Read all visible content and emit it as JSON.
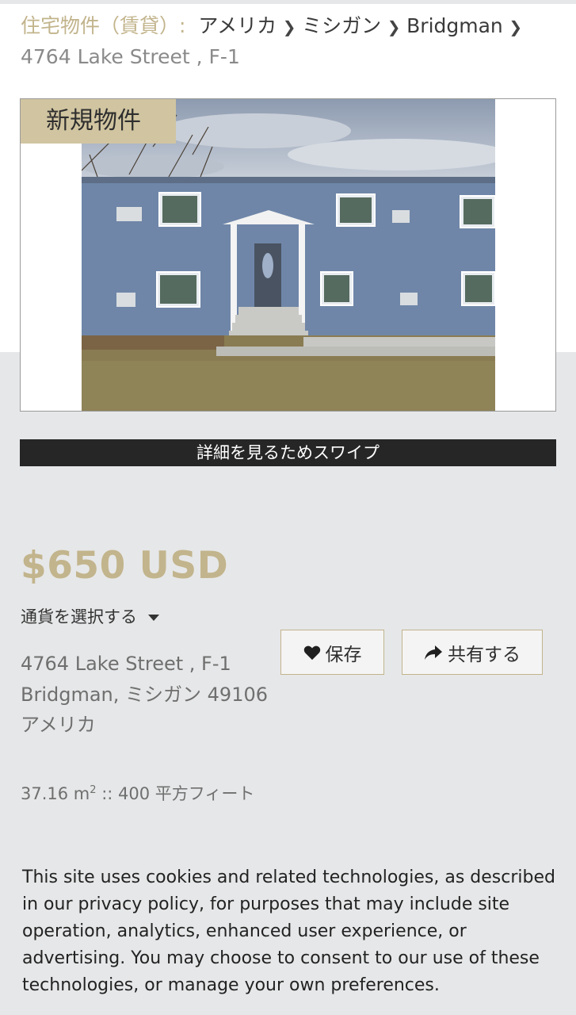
{
  "breadcrumb": {
    "category": "住宅物件（賃貸）",
    "colon": ":",
    "items": [
      "アメリカ",
      "ミシガン",
      "Bridgman"
    ],
    "address": "4764 Lake Street , F-1"
  },
  "listing": {
    "badge": "新規物件",
    "swipe_hint": "詳細を見るためスワイプ",
    "price": "$650 USD",
    "currency_selector": "通貨を選択する",
    "save_label": "保存",
    "share_label": "共有する",
    "address_line1": "4764 Lake Street , F-1",
    "address_line2": "Bridgman, ミシガン 49106",
    "address_line3": "アメリカ",
    "area_metric_value": "37.16 m",
    "area_metric_exponent": "2",
    "area_imperial": " :: 400 平方フィート"
  },
  "cookie_notice": {
    "text": "This site uses cookies and related technologies, as described in our privacy policy, for purposes that may include site operation, analytics, enhanced user experience, or advertising. You may choose to consent to our use of these technologies, or manage your own preferences."
  },
  "colors": {
    "accent": "#c2b48c",
    "badge_bg": "#d1c5a1",
    "bar_bg": "#262626",
    "page_bg": "#e6e7e8"
  },
  "icons": {
    "save": "heart-icon",
    "share": "share-arrow-icon",
    "dropdown": "caret-down-icon",
    "breadcrumb_sep": "chevron-right-icon"
  }
}
